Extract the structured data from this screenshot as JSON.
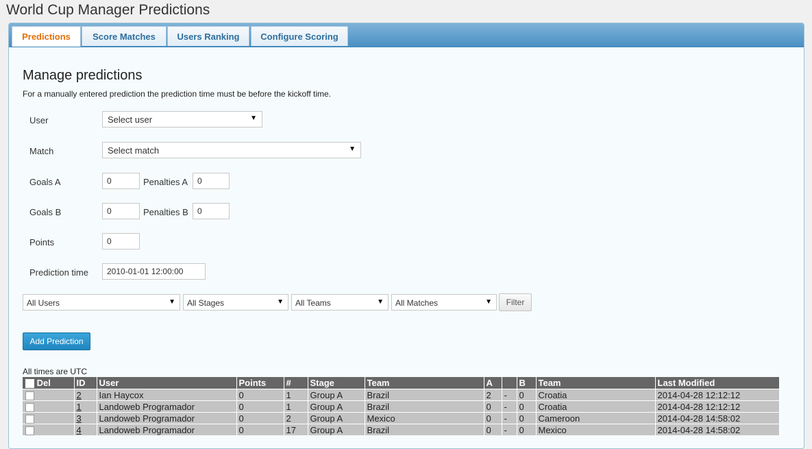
{
  "app": {
    "title": "World Cup Manager Predictions"
  },
  "tabs": [
    {
      "label": "Predictions",
      "active": true
    },
    {
      "label": "Score Matches"
    },
    {
      "label": "Users Ranking"
    },
    {
      "label": "Configure Scoring"
    }
  ],
  "form": {
    "heading": "Manage predictions",
    "note": "For a manually entered prediction the prediction time must be before the kickoff time.",
    "user_label": "User",
    "user_value": "Select user",
    "match_label": "Match",
    "match_value": "Select match",
    "goals_a_label": "Goals A",
    "goals_a_value": "0",
    "penalties_a_label": "Penalties A",
    "penalties_a_value": "0",
    "goals_b_label": "Goals B",
    "goals_b_value": "0",
    "penalties_b_label": "Penalties B",
    "penalties_b_value": "0",
    "points_label": "Points",
    "points_value": "0",
    "prediction_time_label": "Prediction time",
    "prediction_time_value": "2010-01-01 12:00:00"
  },
  "filters": {
    "users": "All Users",
    "stages": "All Stages",
    "teams": "All Teams",
    "matches": "All Matches",
    "filter_label": "Filter"
  },
  "add_button": "Add Prediction",
  "times_note": "All times are UTC",
  "table": {
    "headers": [
      "Del",
      "ID",
      "User",
      "Points",
      "#",
      "Stage",
      "Team",
      "A",
      "",
      "B",
      "Team",
      "Last Modified"
    ],
    "rows": [
      [
        "2",
        "Ian Haycox",
        "0",
        "1",
        "Group A",
        "Brazil",
        "2",
        "-",
        "0",
        "Croatia",
        "2014-04-28 12:12:12"
      ],
      [
        "1",
        "Landoweb Programador",
        "0",
        "1",
        "Group A",
        "Brazil",
        "0",
        "-",
        "0",
        "Croatia",
        "2014-04-28 12:12:12"
      ],
      [
        "3",
        "Landoweb Programador",
        "0",
        "2",
        "Group A",
        "Mexico",
        "0",
        "-",
        "0",
        "Cameroon",
        "2014-04-28 14:58:02"
      ],
      [
        "4",
        "Landoweb Programador",
        "0",
        "17",
        "Group A",
        "Brazil",
        "0",
        "-",
        "0",
        "Mexico",
        "2014-04-28 14:58:02"
      ]
    ]
  },
  "colors": {
    "active_tab": "#e17009",
    "tab_text": "#2e6e9e",
    "primary_button": "#2a97cf",
    "table_header": "#666666"
  }
}
